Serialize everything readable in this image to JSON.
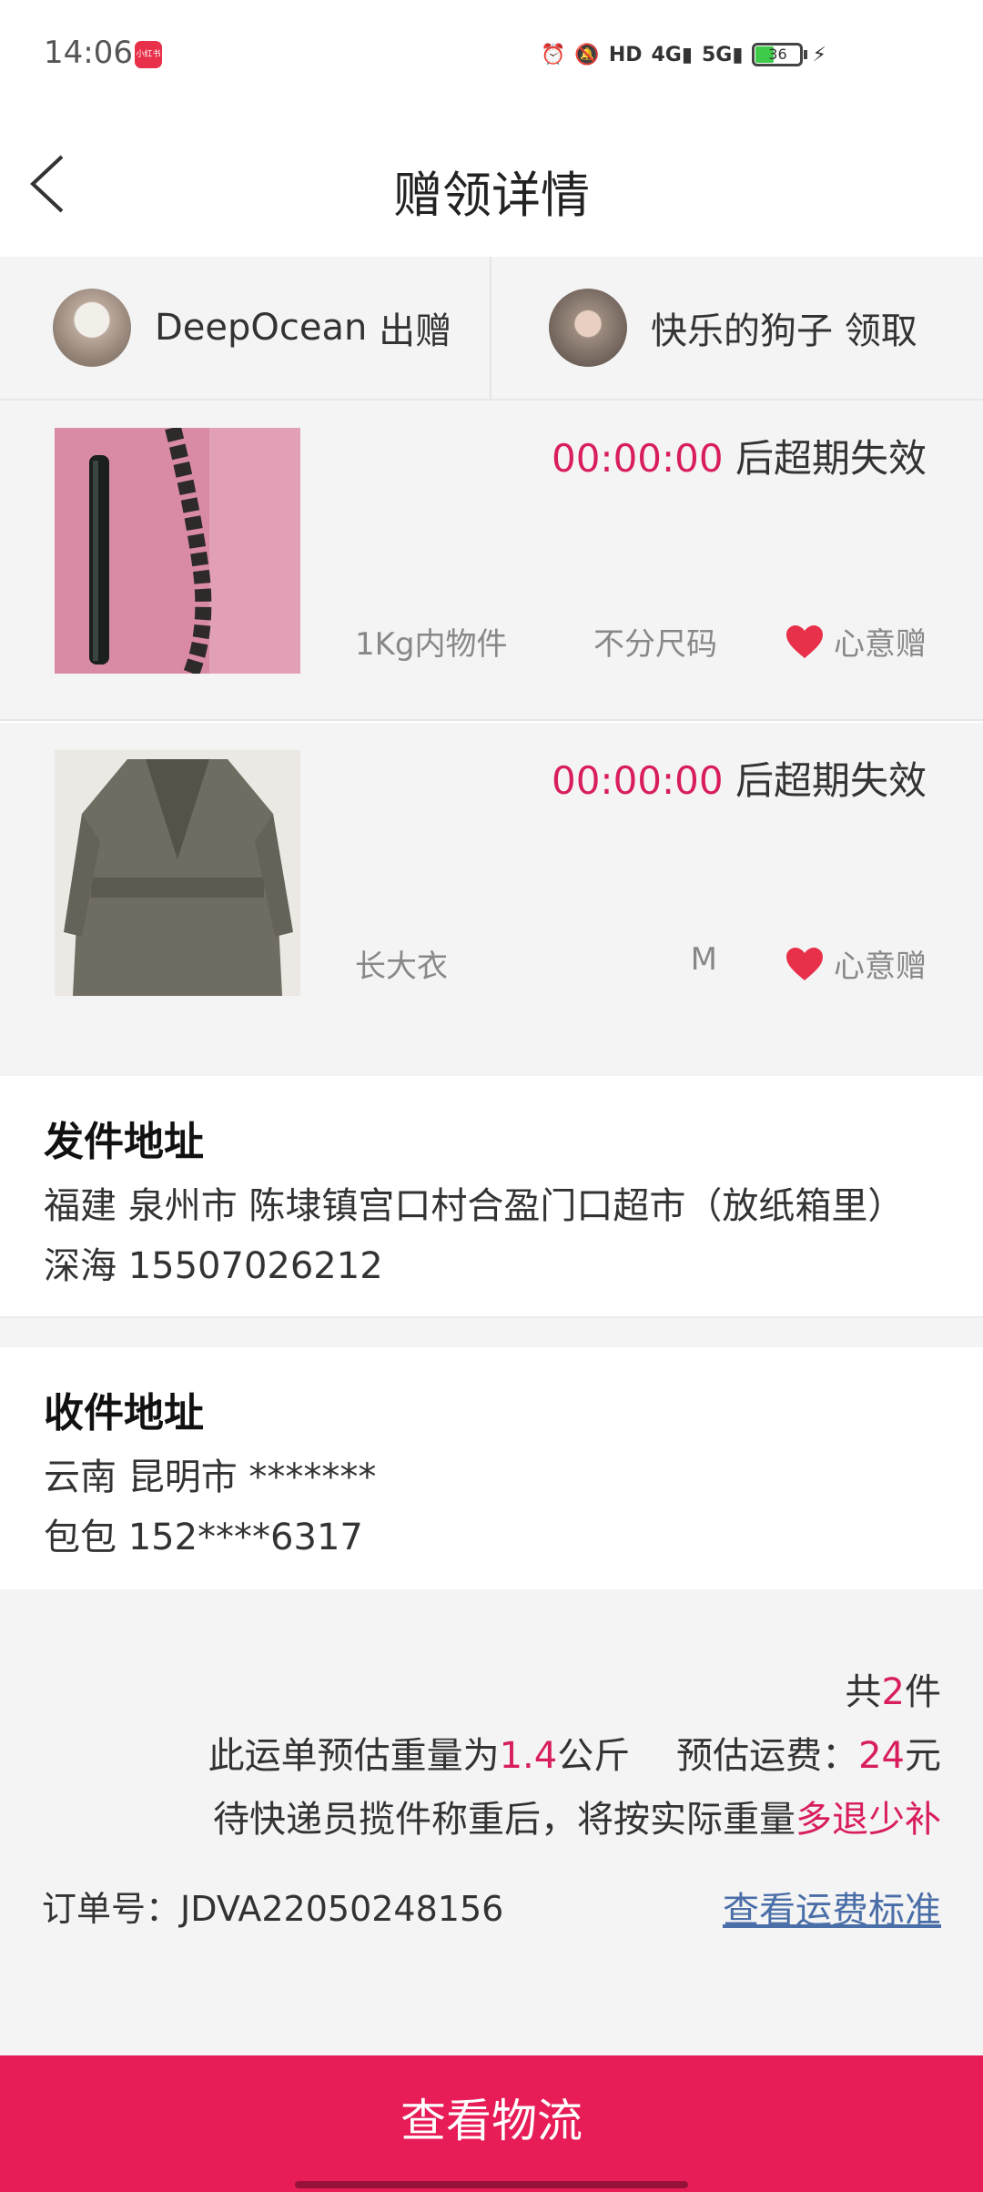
{
  "status_bar": {
    "time": "14:06",
    "app_badge": "小红书",
    "icons": [
      "alarm-icon",
      "mute-icon",
      "hd-icon",
      "4g-signal-icon",
      "5g-signal-icon",
      "battery-icon",
      "charging-icon"
    ],
    "battery_level": "36"
  },
  "nav": {
    "title": "赠领详情",
    "back_icon": "chevron-left-icon"
  },
  "users": {
    "giver": {
      "name": "DeepOcean",
      "action": "出赠"
    },
    "receiver": {
      "name": "快乐的狗子",
      "action": "领取"
    }
  },
  "items": [
    {
      "countdown": "00:00:00",
      "expire_text": "后超期失效",
      "name": "1Kg内物件",
      "size": "不分尺码",
      "gift_label": "心意赠",
      "gift_icon": "heart-icon"
    },
    {
      "countdown": "00:00:00",
      "expire_text": "后超期失效",
      "name": "长大衣",
      "size": "M",
      "gift_label": "心意赠",
      "gift_icon": "heart-icon"
    }
  ],
  "sender": {
    "title": "发件地址",
    "address": "福建 泉州市 陈埭镇宫口村合盈门口超市（放纸箱里）",
    "contact": "深海 15507026212"
  },
  "receiver_address": {
    "title": "收件地址",
    "address": "云南 昆明市 *******",
    "contact": "包包 152****6317"
  },
  "summary": {
    "count_prefix": "共",
    "count": "2",
    "count_suffix": "件",
    "weight_prefix": "此运单预估重量为",
    "weight": "1.4",
    "weight_unit": "公斤",
    "fee_label": "预估运费：",
    "fee": "24",
    "fee_unit": "元",
    "note_prefix": "待快递员揽件称重后，将按实际重量",
    "note_highlight": "多退少补",
    "order_label": "订单号：",
    "order_no": "JDVA22050248156",
    "fee_standard_link": "查看运费标准"
  },
  "bottom_button": "查看物流",
  "colors": {
    "accent": "#e81c56",
    "highlight_text": "#d81e5b",
    "link": "#4a6ea8",
    "heart": "#e8304a"
  }
}
